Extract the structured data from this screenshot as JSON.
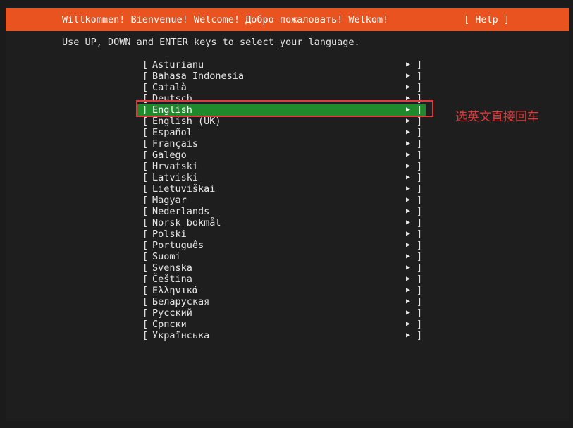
{
  "header": {
    "title": "Willkommen! Bienvenue! Welcome! Добро пожаловать! Welkom!",
    "help_label": "[ Help ]"
  },
  "instructions": "Use UP, DOWN and ENTER keys to select your language.",
  "languages": [
    {
      "label": "Asturianu"
    },
    {
      "label": "Bahasa Indonesia"
    },
    {
      "label": "Català"
    },
    {
      "label": "Deutsch"
    },
    {
      "label": "English",
      "selected": true
    },
    {
      "label": "English (UK)"
    },
    {
      "label": "Español"
    },
    {
      "label": "Français"
    },
    {
      "label": "Galego"
    },
    {
      "label": "Hrvatski"
    },
    {
      "label": "Latviski"
    },
    {
      "label": "Lietuviškai"
    },
    {
      "label": "Magyar"
    },
    {
      "label": "Nederlands"
    },
    {
      "label": "Norsk bokmål"
    },
    {
      "label": "Polski"
    },
    {
      "label": "Português"
    },
    {
      "label": "Suomi"
    },
    {
      "label": "Svenska"
    },
    {
      "label": "Čeština"
    },
    {
      "label": "Ελληνικά"
    },
    {
      "label": "Беларуская"
    },
    {
      "label": "Русский"
    },
    {
      "label": "Српски"
    },
    {
      "label": "Українська"
    }
  ],
  "list_symbols": {
    "open_bracket": "[",
    "close_bracket": "]",
    "arrow": "▶"
  },
  "annotation": {
    "text": "选英文直接回车"
  },
  "colors": {
    "header_bg": "#e9531f",
    "selected_bg": "#1f8a2b",
    "annotation": "#e03b3b",
    "terminal_bg": "#1e1e1e"
  }
}
